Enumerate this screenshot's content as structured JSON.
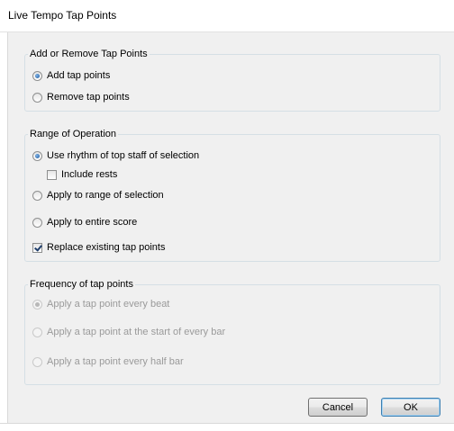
{
  "window": {
    "title": "Live Tempo Tap Points"
  },
  "groups": {
    "add_remove": {
      "title": "Add or Remove Tap Points",
      "options": [
        "Add tap points",
        "Remove tap points"
      ],
      "selected": "Add tap points"
    },
    "range": {
      "title": "Range of Operation",
      "options": [
        "Use rhythm of top staff of selection",
        "Apply to range of selection",
        "Apply to entire score"
      ],
      "selected": "Use rhythm of top staff of selection",
      "include_rests": {
        "label": "Include rests",
        "checked": false
      },
      "replace_existing": {
        "label": "Replace existing tap points",
        "checked": true
      }
    },
    "frequency": {
      "title": "Frequency of tap points",
      "enabled": false,
      "options": [
        "Apply a tap point every beat",
        "Apply a tap point at the start of every bar",
        "Apply a tap point every half bar"
      ],
      "selected": "Apply a tap point every beat"
    }
  },
  "buttons": {
    "cancel": "Cancel",
    "ok": "OK"
  }
}
